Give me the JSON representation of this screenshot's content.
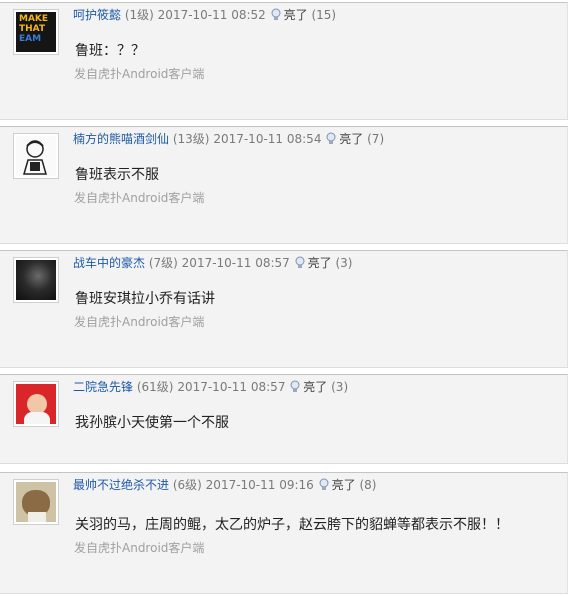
{
  "comments": [
    {
      "username": "呵护筱懿",
      "level": "(1级)",
      "time": "2017-10-11 08:52",
      "light_label": "亮了",
      "light_count": "(15)",
      "content": "鲁班：？？",
      "source": "发自虎扑Android客户端",
      "avatar_text": [
        "MAKE",
        "THAT",
        "EAM"
      ]
    },
    {
      "username": "楠方的熊喵酒剑仙",
      "level": "(13级)",
      "time": "2017-10-11 08:54",
      "light_label": "亮了",
      "light_count": "(7)",
      "content": "鲁班表示不服",
      "source": "发自虎扑Android客户端"
    },
    {
      "username": "战车中的豪杰",
      "level": "(7级)",
      "time": "2017-10-11 08:57",
      "light_label": "亮了",
      "light_count": "(3)",
      "content": "鲁班安琪拉小乔有话讲",
      "source": "发自虎扑Android客户端"
    },
    {
      "username": "二院急先锋",
      "level": "(61级)",
      "time": "2017-10-11 08:57",
      "light_label": "亮了",
      "light_count": "(3)",
      "content": "我孙膑小天使第一个不服"
    },
    {
      "username": "最帅不过绝杀不进",
      "level": "(6级)",
      "time": "2017-10-11 09:16",
      "light_label": "亮了",
      "light_count": "(8)",
      "content": "关羽的马，庄周的鲲，太乙的炉子，赵云胯下的貂蝉等都表示不服！！",
      "source": "发自虎扑Android客户端"
    }
  ],
  "colors": {
    "username": "#1f5aa6",
    "meta": "#777777",
    "source": "#a0a0a0",
    "background": "#f3f3f3"
  },
  "icons": {
    "light": "lightbulb-icon"
  }
}
